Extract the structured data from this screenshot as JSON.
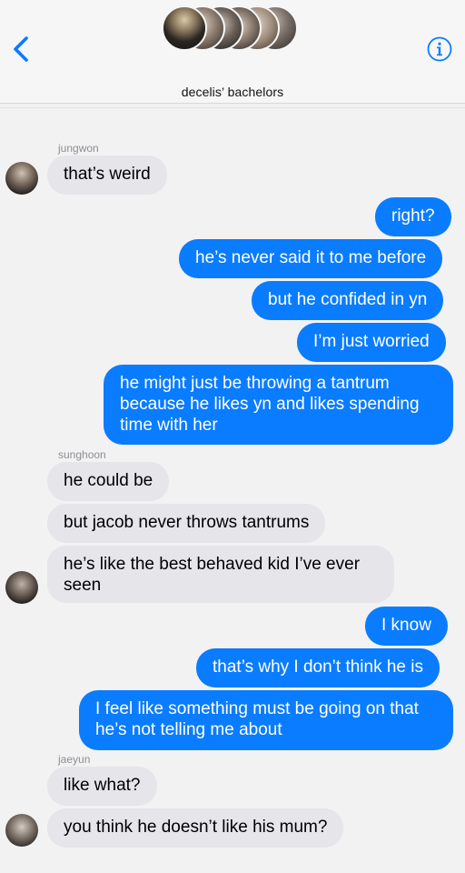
{
  "header": {
    "group_name": "decelis’ bachelors",
    "back_icon": "chevron-left-icon",
    "info_icon": "info-icon",
    "accent_color": "#0a7cff"
  },
  "messages": [
    {
      "sender": "jungwon",
      "text": "that’s weird"
    },
    {
      "text": "right?"
    },
    {
      "text": "he’s never said it to me before"
    },
    {
      "text": "but he confided in yn"
    },
    {
      "text": "I’m just worried"
    },
    {
      "text": "he might just be throwing a tantrum because he likes yn and likes spending time with her"
    },
    {
      "sender": "sunghoon",
      "text": "he could be"
    },
    {
      "text": "but jacob never throws tantrums"
    },
    {
      "text": "he’s like the best behaved kid I’ve ever seen"
    },
    {
      "text": "I know"
    },
    {
      "text": "that’s why I don’t think he is"
    },
    {
      "text": "I feel like something must be going on that he’s not telling me about"
    },
    {
      "sender": "jaeyun",
      "text": "like what?"
    },
    {
      "text": "you think he doesn’t like his mum?"
    }
  ]
}
